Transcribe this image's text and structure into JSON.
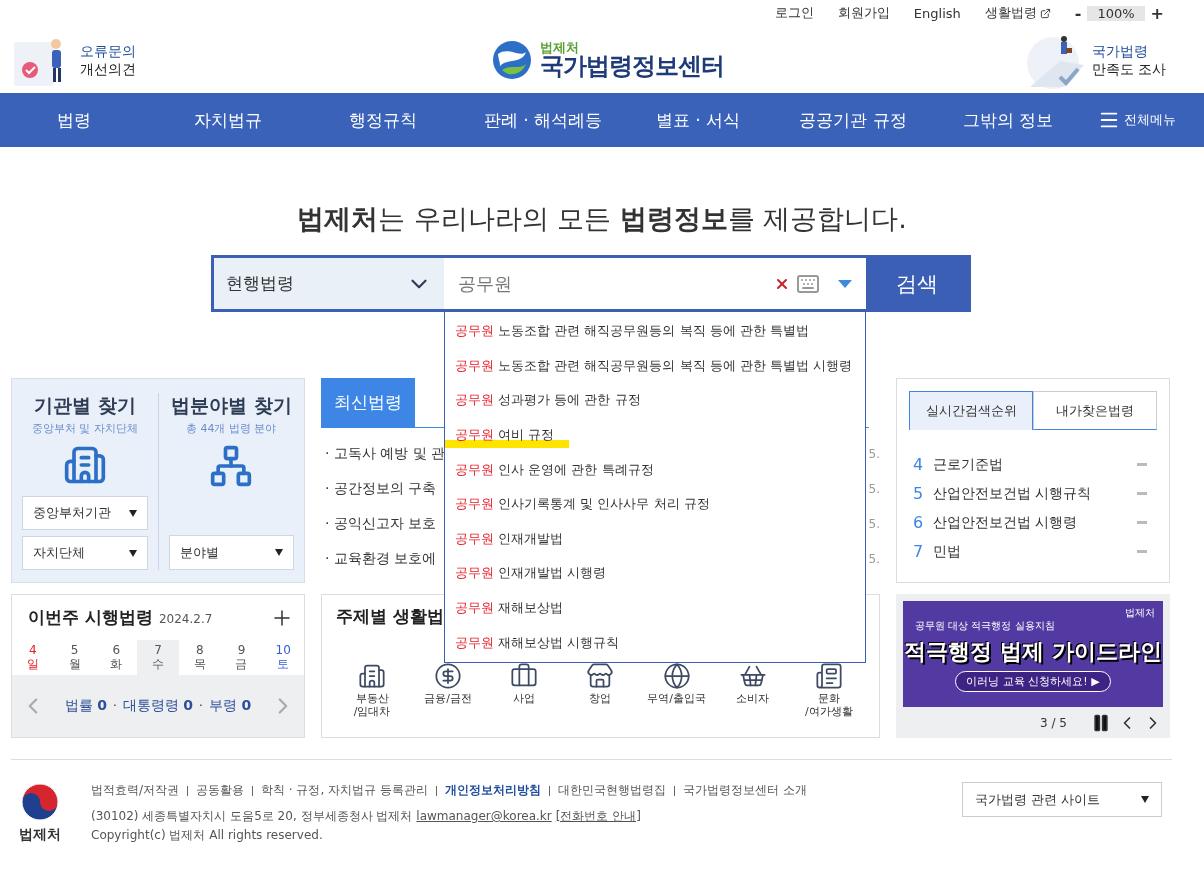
{
  "util_links": [
    {
      "label": "로그인",
      "external": false
    },
    {
      "label": "회원가입",
      "external": false
    },
    {
      "label": "English",
      "external": false
    },
    {
      "label": "생활법령",
      "external": true
    }
  ],
  "zoom": {
    "minus": "-",
    "value": "100%",
    "plus": "+"
  },
  "header": {
    "feedback": {
      "line1": "오류문의",
      "line2": "개선의견"
    },
    "logo": {
      "small": "법제처",
      "title": "국가법령정보센터"
    },
    "survey": {
      "line1": "국가법령",
      "line2": "만족도 조사"
    }
  },
  "nav": {
    "items": [
      "법령",
      "자치법규",
      "행정규칙",
      "판례 · 해석례등",
      "별표 · 서식",
      "공공기관 규정",
      "그밖의 정보"
    ],
    "all_menu": "전체메뉴"
  },
  "hero": {
    "headline": "**법제처**는 우리나라의 모든 **법령정보**를 제공합니다."
  },
  "search": {
    "scope": "현행법령",
    "query": "공무원",
    "button": "검색"
  },
  "suggestions": [
    {
      "match": "공무원",
      "rest": " 노동조합 관련 해직공무원등의 복직 등에 관한 특별법",
      "highlighted": false
    },
    {
      "match": "공무원",
      "rest": " 노동조합 관련 해직공무원등의 복직 등에 관한 특별법 시행령",
      "highlighted": false
    },
    {
      "match": "공무원",
      "rest": " 성과평가 등에 관한 규정",
      "highlighted": false
    },
    {
      "match": "공무원",
      "rest": " 여비 규정",
      "highlighted": true
    },
    {
      "match": "공무원",
      "rest": " 인사 운영에 관한 특례규정",
      "highlighted": false
    },
    {
      "match": "공무원",
      "rest": " 인사기록통계 및 인사사무 처리 규정",
      "highlighted": false
    },
    {
      "match": "공무원",
      "rest": " 인재개발법",
      "highlighted": false
    },
    {
      "match": "공무원",
      "rest": " 인재개발법 시행령",
      "highlighted": false
    },
    {
      "match": "공무원",
      "rest": " 재해보상법",
      "highlighted": false
    },
    {
      "match": "공무원",
      "rest": " 재해보상법 시행규칙",
      "highlighted": false
    }
  ],
  "finders": [
    {
      "title": "기관별 찾기",
      "subtitle": "중앙부처 및 자치단체",
      "selects": [
        "중앙부처기관",
        "자치단체"
      ]
    },
    {
      "title": "법분야별 찾기",
      "subtitle": "총 44개 법령 분야",
      "selects": [
        "분야별"
      ]
    }
  ],
  "news": {
    "tab": "최신법령",
    "items": [
      {
        "text": "· 고독사 예방 및 관",
        "date": "5."
      },
      {
        "text": "· 공간정보의 구축",
        "date": "5."
      },
      {
        "text": "· 공익신고자 보호",
        "date": "5."
      },
      {
        "text": "· 교육환경 보호에",
        "date": "5."
      }
    ]
  },
  "weekly": {
    "title": "이번주 시행법령",
    "date": "2024.2.7",
    "separator": "·",
    "days": [
      {
        "num": "4",
        "day": "일",
        "kind": "sunday",
        "selected": false
      },
      {
        "num": "5",
        "day": "월",
        "kind": "weekday",
        "selected": false
      },
      {
        "num": "6",
        "day": "화",
        "kind": "weekday",
        "selected": false
      },
      {
        "num": "7",
        "day": "수",
        "kind": "weekday",
        "selected": true
      },
      {
        "num": "8",
        "day": "목",
        "kind": "weekday",
        "selected": false
      },
      {
        "num": "9",
        "day": "금",
        "kind": "weekday",
        "selected": false
      },
      {
        "num": "10",
        "day": "토",
        "kind": "saturday",
        "selected": false
      }
    ],
    "counts": [
      {
        "label": "법률",
        "value": "0"
      },
      {
        "label": "대통령령",
        "value": "0"
      },
      {
        "label": "부령",
        "value": "0"
      }
    ]
  },
  "topics": {
    "title": "주제별 생활법",
    "items": [
      [
        "부동산",
        "/임대차"
      ],
      [
        "금융/금전"
      ],
      [
        "사업"
      ],
      [
        "창업"
      ],
      [
        "무역/출입국"
      ],
      [
        "소비자"
      ],
      [
        "문화",
        "/여가생활"
      ]
    ]
  },
  "ranking": {
    "tabs": [
      {
        "label": "실시간검색순위",
        "selected": true
      },
      {
        "label": "내가찾은법령",
        "selected": false
      }
    ],
    "items": [
      {
        "rank": "4",
        "name": "근로기준법"
      },
      {
        "rank": "5",
        "name": "산업안전보건법 시행규칙"
      },
      {
        "rank": "6",
        "name": "산업안전보건법 시행령"
      },
      {
        "rank": "7",
        "name": "민법"
      }
    ]
  },
  "banner": {
    "org": "법제처",
    "subtitle": "공무원 대상 적극행정 실용지침",
    "title": "적극행정 법제 가이드라인",
    "cta": "이러닝 교육 신청하세요! ▶",
    "pager": "3 / 5"
  },
  "footer": {
    "links": [
      {
        "label": "법적효력/저작권",
        "bold": false
      },
      {
        "label": "공동활용",
        "bold": false
      },
      {
        "label": "학칙 · 규정, 자치법규 등록관리",
        "bold": false
      },
      {
        "label": "개인정보처리방침",
        "bold": true
      },
      {
        "label": "대한민국현행법령집",
        "bold": false
      },
      {
        "label": "국가법령정보센터 소개",
        "bold": false
      }
    ],
    "address": "(30102) 세종특별자치시 도움5로 20, 정부세종청사 법제처",
    "email": "lawmanager@korea.kr",
    "phone": "[전화번호 안내]",
    "copyright": "Copyright(c) 법제처 All rights reserved.",
    "org": "법제처",
    "site_select": "국가법령 관련 사이트"
  }
}
